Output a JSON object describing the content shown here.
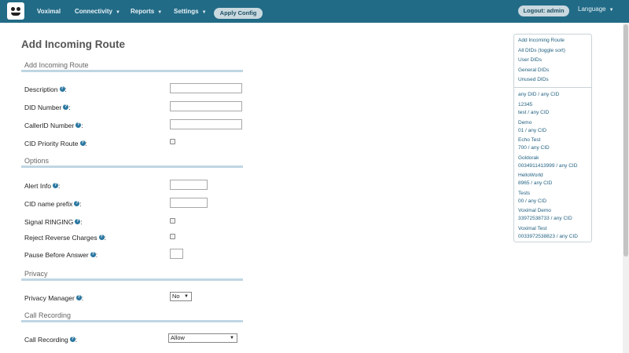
{
  "nav": {
    "brand": "Voximal",
    "connectivity": "Connectivity",
    "reports": "Reports",
    "settings": "Settings",
    "apply_config": "Apply Config",
    "logout": "Logout: admin",
    "language": "Language",
    "caret": "▼"
  },
  "page": {
    "title": "Add Incoming Route"
  },
  "sections": {
    "add_route": "Add Incoming Route",
    "options": "Options",
    "privacy": "Privacy",
    "call_recording": "Call Recording"
  },
  "fields": {
    "description": "Description",
    "did_number": "DID Number",
    "callerid_number": "CallerID Number",
    "cid_priority_route": "CID Priority Route",
    "alert_info": "Alert Info",
    "cid_name_prefix": "CID name prefix",
    "signal_ringing": "Signal RINGING",
    "reject_reverse_charges": "Reject Reverse Charges",
    "pause_before_answer": "Pause Before Answer",
    "privacy_manager": "Privacy Manager",
    "call_recording": "Call Recording"
  },
  "help_glyph": "?",
  "colon": ":",
  "values": {
    "privacy_manager": "No",
    "call_recording": "Allow"
  },
  "sidebar": {
    "links": [
      "Add Incoming Route",
      "All DIDs (toggle sort)",
      "User DIDs",
      "General DIDs",
      "Unused DIDs"
    ],
    "routes": [
      "any DID / any CID",
      "12345",
      "test / any CID",
      "Demo",
      "01 / any CID",
      "Echo Test",
      "700 / any CID",
      "Goldorak",
      "0034911413999 / any CID",
      "HelloWorld",
      "8965 / any CID",
      "Tests",
      "00 / any CID",
      "Voximal Demo",
      "33972538733 / any CID",
      "Voximal Test",
      "0033972538823 / any CID"
    ]
  },
  "colors": {
    "topbar": "#226b87",
    "accent": "#2b77a0",
    "section_rule": "#bfd6e3"
  }
}
